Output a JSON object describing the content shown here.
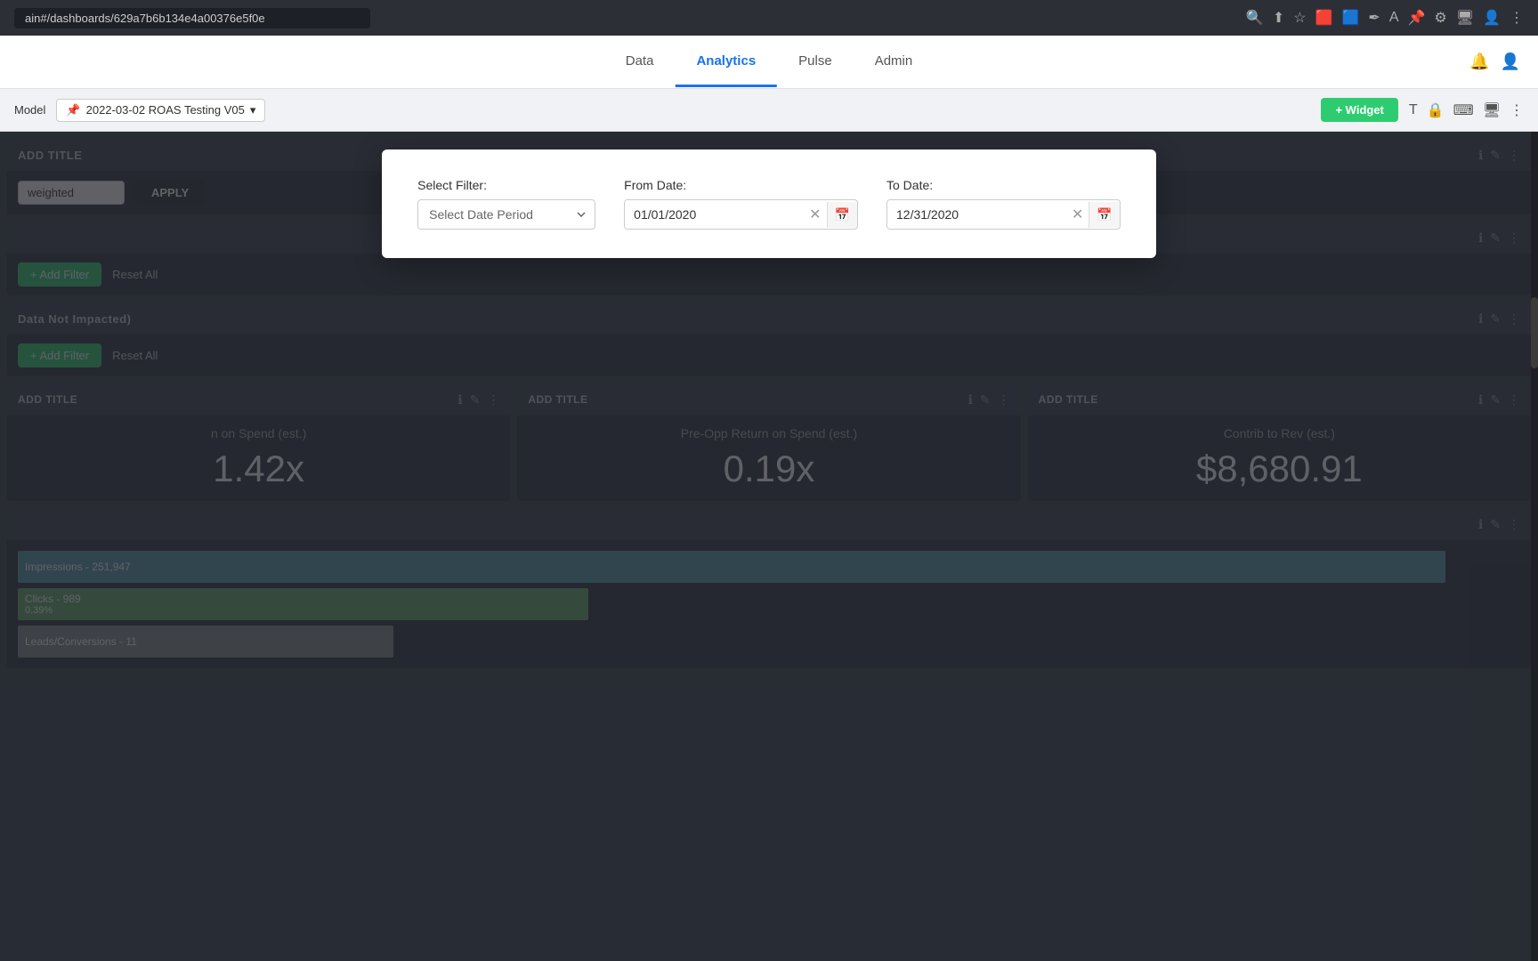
{
  "browser": {
    "url": "ain#/dashboards/629a7b6b134e4a00376e5f0e",
    "icons": [
      "🔍",
      "⬆",
      "★",
      "🟥",
      "🟦",
      "🖋",
      "A",
      "📌",
      "⚙",
      "🖥",
      "👤",
      "⋮"
    ]
  },
  "nav": {
    "tabs": [
      {
        "label": "Data",
        "active": false
      },
      {
        "label": "Analytics",
        "active": true
      },
      {
        "label": "Pulse",
        "active": false
      },
      {
        "label": "Admin",
        "active": false
      }
    ],
    "bell_icon": "🔔",
    "user_icon": "👤"
  },
  "toolbar": {
    "model_label": "Model",
    "version_label": "2022-03-02 ROAS Testing V05",
    "add_widget_label": "+ Widget",
    "text_icon": "T",
    "lock_icon": "🔒",
    "keyboard_icon": "⌨",
    "monitor_icon": "🖥",
    "more_icon": "⋮"
  },
  "sections": {
    "section1": {
      "title": "ADD TITLE",
      "filter_label": "weighted",
      "apply_label": "APPLY",
      "icons": [
        "ℹ",
        "✎",
        "⋮"
      ]
    },
    "section2": {
      "title": "",
      "add_filter_label": "+ Add Filter",
      "reset_all_label": "Reset All",
      "icons": [
        "ℹ",
        "✎",
        "⋮"
      ]
    },
    "section3": {
      "title": "Data Not Impacted)",
      "add_filter_label": "+ Add Filter",
      "reset_all_label": "Reset All",
      "icons": [
        "ℹ",
        "✎",
        "⋮"
      ]
    }
  },
  "metrics": [
    {
      "header_title": "ADD TITLE",
      "label": "n on Spend (est.)",
      "value": "1.42x",
      "header_icons": [
        "ℹ",
        "✎",
        "⋮"
      ]
    },
    {
      "header_title": "ADD TITLE",
      "label": "Pre-Opp Return on Spend (est.)",
      "value": "0.19x",
      "header_icons": [
        "ℹ",
        "✎",
        "⋮"
      ]
    },
    {
      "header_title": "ADD TITLE",
      "label": "Contrib to Rev (est.)",
      "value": "$8,680.91",
      "header_icons": [
        "ℹ",
        "✎",
        "⋮"
      ]
    }
  ],
  "chart": {
    "header_icons": [
      "ℹ",
      "✎",
      "⋮"
    ],
    "bars": [
      {
        "label": "Impressions - 251,947",
        "width_pct": 95,
        "color": "#5b9baf"
      },
      {
        "label": "Clicks - 989\n0.39%",
        "width_pct": 38,
        "color": "#6aaa6a"
      },
      {
        "label": "Leads/Conversions - 11",
        "width_pct": 25,
        "color": "#8c8c8c"
      }
    ]
  },
  "modal": {
    "select_filter_label": "Select Filter:",
    "select_filter_placeholder": "Select Date Period",
    "from_date_label": "From Date:",
    "from_date_value": "01/01/2020",
    "to_date_label": "To Date:",
    "to_date_value": "12/31/2020"
  }
}
